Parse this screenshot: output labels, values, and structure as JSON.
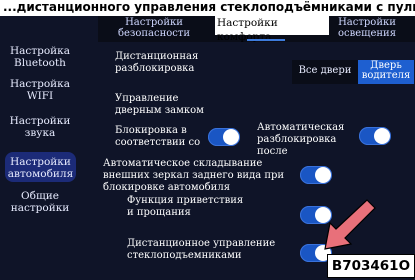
{
  "header": {
    "text": "...дистанционного управления стеклоподъёмниками с пульта дистанционного управления..."
  },
  "sidebar": {
    "items": [
      {
        "label": "Настройка Bluetooth"
      },
      {
        "label": "Настройка WIFI"
      },
      {
        "label": "Настройки звука"
      },
      {
        "label": "Настройки автомобиля"
      },
      {
        "label": "Общие настройки"
      }
    ]
  },
  "tabs": [
    {
      "label": "Настройки безопасности"
    },
    {
      "label": "Настройки комфорта"
    },
    {
      "label": "Настройки освещения"
    }
  ],
  "settings": {
    "remote_unlock": "Дистанционная разблокировка",
    "door_lock_control": "Управление дверным замком",
    "lock_by_speed": "Блокировка в соответствии со",
    "auto_unlock_after": "Автоматическая разблокировка после",
    "mirror_fold": "Автоматическое складывание внешних зеркал заднего вида при блокировке автомобиля",
    "welcome_function": "Функция приветствия и прощания",
    "remote_windows": "Дистанционное управление стеклоподъемниками"
  },
  "unlock_mode": {
    "all_doors": "Все двери",
    "driver_door": "Дверь водителя",
    "selected": "Дверь водителя"
  },
  "toggles": {
    "lock_by_speed": true,
    "auto_unlock_after": true,
    "mirror_fold": true,
    "welcome_function": true,
    "remote_windows": true
  },
  "figure_code": "B703461O",
  "colors": {
    "accent": "#1e5fd0",
    "arrow": "#e8707a"
  }
}
